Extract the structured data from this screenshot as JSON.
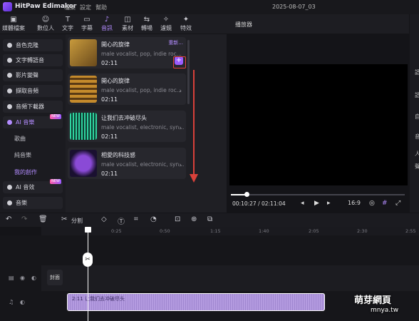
{
  "app": {
    "name": "HitPaw Edimakor",
    "menu": [
      "檔案",
      "設定",
      "幫助"
    ],
    "project_title": "2025-08-07_03"
  },
  "toolbar": [
    {
      "icon": "media-icon",
      "label": "媒體檔案"
    },
    {
      "icon": "avatar-icon",
      "label": "數位人"
    },
    {
      "icon": "text-icon",
      "label": "文字"
    },
    {
      "icon": "subtitle-icon",
      "label": "字幕"
    },
    {
      "icon": "music-icon",
      "label": "音訊",
      "active": true
    },
    {
      "icon": "material-icon",
      "label": "素材"
    },
    {
      "icon": "transition-icon",
      "label": "轉場"
    },
    {
      "icon": "filter-icon",
      "label": "濾鏡"
    },
    {
      "icon": "effect-icon",
      "label": "特效"
    }
  ],
  "sidebar": {
    "items": [
      "音色克隆",
      "文字轉語音",
      "影片變聲",
      "擷取音頻",
      "音頻下載器",
      "AI 音樂"
    ],
    "subitems": [
      "歌曲",
      "純音樂",
      "我的創作"
    ],
    "items2": [
      "AI 音效",
      "音樂"
    ],
    "badge": "NEW"
  },
  "library": {
    "cards": [
      {
        "title": "開心的旋律",
        "desc": "male vocalist, pop, indie roc...",
        "duration": "02:11",
        "action": "重新..."
      },
      {
        "title": "開心的旋律",
        "desc": "male vocalist, pop, indie roc...",
        "duration": "02:11"
      },
      {
        "title": "让我们去冲破尽头",
        "desc": "male vocalist, electronic, syn...",
        "duration": "02:11"
      },
      {
        "title": "相愛的科技感",
        "desc": "male vocalist, electronic, syn...",
        "duration": "02:11"
      }
    ]
  },
  "player": {
    "title": "播放器",
    "time": "00:10:27 / 02:11:04",
    "ratio": "16:9",
    "progress": 0.09
  },
  "right_panel": {
    "labels": [
      "語",
      "語",
      "自",
      "音",
      "人",
      "聲"
    ]
  },
  "timeline": {
    "split_label": "分割",
    "ticks": [
      "0:25",
      "0:50",
      "1:15",
      "1:40",
      "2:05",
      "2:30",
      "2:55"
    ],
    "cover_label": "封面",
    "audio_clip_label": "2:11 让我们去冲破尽头"
  },
  "watermark": {
    "line1": "萌芽網頁",
    "line2": "mnya.tw"
  },
  "colors": {
    "accent": "#9b5cff",
    "annotation": "#d9413a"
  }
}
